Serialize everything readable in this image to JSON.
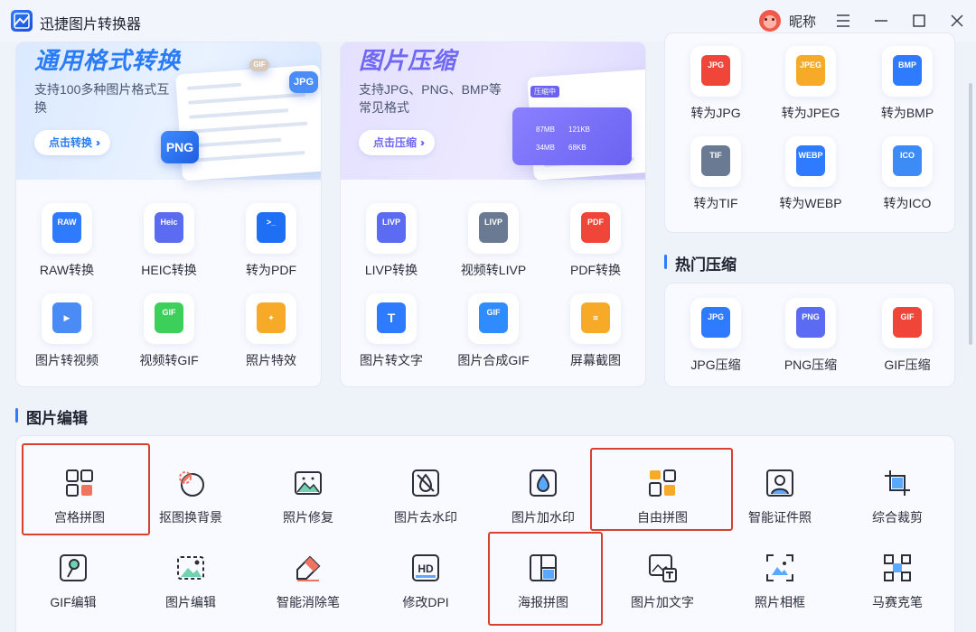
{
  "app": {
    "title": "迅捷图片转换器",
    "nickname": "昵称"
  },
  "colors": {
    "accent": "#2f7bff",
    "highlight": "#d9412f"
  },
  "banners": [
    {
      "title": "通用格式转换",
      "subtitle": "支持100多种图片格式互换",
      "button": "点击转换",
      "chip_top": "GIF",
      "chip_jpg": "JPG",
      "chip_png": "PNG"
    },
    {
      "title": "图片压缩",
      "subtitle": "支持JPG、PNG、BMP等常见格式",
      "button": "点击压缩",
      "mock_head": "压缩中",
      "row1": [
        "87MB",
        "121KB"
      ],
      "row2": [
        "34MB",
        "68KB"
      ]
    }
  ],
  "card1_tools": [
    {
      "label": "RAW转换",
      "icon": "raw-icon",
      "tag": "RAW",
      "color": "#2f7bff"
    },
    {
      "label": "HEIC转换",
      "icon": "heic-icon",
      "tag": "Heic",
      "color": "#5b6cf2"
    },
    {
      "label": "转为PDF",
      "icon": "pdf-doc-icon",
      "tag": ">_",
      "color": "#1f6ff5"
    },
    {
      "label": "图片转视频",
      "icon": "image-to-video-icon",
      "tag": "",
      "color": "#4a8bf5"
    },
    {
      "label": "视频转GIF",
      "icon": "video-to-gif-icon",
      "tag": "GIF",
      "color": "#3ccf5a"
    },
    {
      "label": "照片特效",
      "icon": "photo-effect-icon",
      "tag": "",
      "color": "#f7a928"
    }
  ],
  "card2_tools": [
    {
      "label": "LIVP转换",
      "icon": "livp-icon",
      "tag": "LIVP",
      "color": "#5b6cf2"
    },
    {
      "label": "视频转LIVP",
      "icon": "video-to-livp-icon",
      "tag": "LIVP",
      "color": "#6a7a93"
    },
    {
      "label": "PDF转换",
      "icon": "pdf-convert-icon",
      "tag": "PDF",
      "color": "#f0463a"
    },
    {
      "label": "图片转文字",
      "icon": "image-to-text-icon",
      "tag": "T",
      "color": "#2f7bff"
    },
    {
      "label": "图片合成GIF",
      "icon": "merge-gif-icon",
      "tag": "GIF",
      "color": "#2f8cff"
    },
    {
      "label": "屏幕截图",
      "icon": "screenshot-icon",
      "tag": "",
      "color": "#f7a928"
    }
  ],
  "format_tools": [
    {
      "label": "转为JPG",
      "icon": "jpg-icon",
      "tag": "JPG",
      "color": "#f0463a"
    },
    {
      "label": "转为JPEG",
      "icon": "jpeg-icon",
      "tag": "JPEG",
      "color": "#f7a928"
    },
    {
      "label": "转为BMP",
      "icon": "bmp-icon",
      "tag": "BMP",
      "color": "#2f7bff"
    },
    {
      "label": "转为TIF",
      "icon": "tif-icon",
      "tag": "TIF",
      "color": "#6a7a93"
    },
    {
      "label": "转为WEBP",
      "icon": "webp-icon",
      "tag": "WEBP",
      "color": "#2f7bff"
    },
    {
      "label": "转为ICO",
      "icon": "ico-icon",
      "tag": "ICO",
      "color": "#3d8cf5"
    }
  ],
  "hot_compress": {
    "title": "热门压缩",
    "items": [
      {
        "label": "JPG压缩",
        "icon": "jpg-compress-icon",
        "tag": "JPG",
        "color": "#2f7bff"
      },
      {
        "label": "PNG压缩",
        "icon": "png-compress-icon",
        "tag": "PNG",
        "color": "#5b6cf2"
      },
      {
        "label": "GIF压缩",
        "icon": "gif-compress-icon",
        "tag": "GIF",
        "color": "#f0463a"
      }
    ]
  },
  "image_edit": {
    "title": "图片编辑",
    "row1": [
      {
        "label": "宫格拼图",
        "icon": "grid-collage-icon",
        "highlighted": true
      },
      {
        "label": "抠图换背景",
        "icon": "cutout-icon",
        "highlighted": false
      },
      {
        "label": "照片修复",
        "icon": "photo-repair-icon",
        "highlighted": false
      },
      {
        "label": "图片去水印",
        "icon": "remove-watermark-icon",
        "highlighted": false
      },
      {
        "label": "图片加水印",
        "icon": "add-watermark-icon",
        "highlighted": false
      },
      {
        "label": "自由拼图",
        "icon": "free-collage-icon",
        "highlighted": true
      },
      {
        "label": "智能证件照",
        "icon": "id-photo-icon",
        "highlighted": false
      },
      {
        "label": "综合裁剪",
        "icon": "crop-icon",
        "highlighted": false
      }
    ],
    "row2": [
      {
        "label": "GIF编辑",
        "icon": "gif-edit-icon",
        "highlighted": false
      },
      {
        "label": "图片编辑",
        "icon": "image-edit-icon",
        "highlighted": false
      },
      {
        "label": "智能消除笔",
        "icon": "eraser-pen-icon",
        "highlighted": false
      },
      {
        "label": "修改DPI",
        "icon": "dpi-icon",
        "highlighted": false
      },
      {
        "label": "海报拼图",
        "icon": "poster-collage-icon",
        "highlighted": true
      },
      {
        "label": "图片加文字",
        "icon": "add-text-icon",
        "highlighted": false
      },
      {
        "label": "照片相框",
        "icon": "photo-frame-icon",
        "highlighted": false
      },
      {
        "label": "马赛克笔",
        "icon": "mosaic-icon",
        "highlighted": false
      }
    ]
  }
}
